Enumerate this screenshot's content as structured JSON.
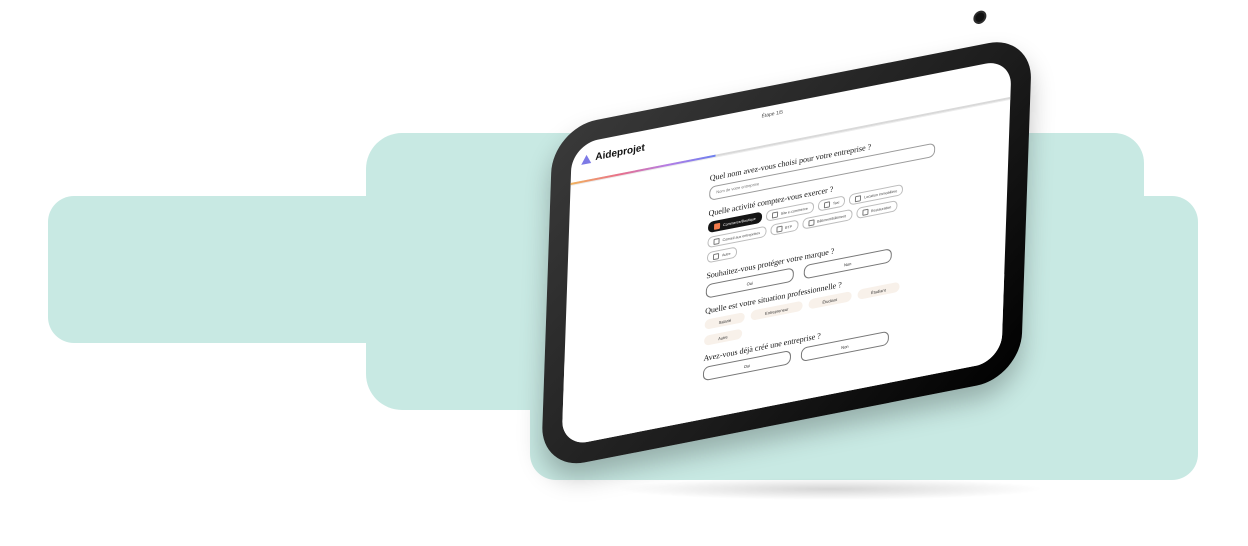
{
  "app": {
    "brand": "Aideprojet",
    "step": "Étape 1/5",
    "progress": 0.33
  },
  "questions": {
    "company_name": {
      "label": "Quel nom avez-vous choisi pour votre entreprise ?",
      "placeholder": "Nom de votre entreprise"
    },
    "activity": {
      "label": "Quelle activité comptez-vous exercer ?",
      "options": [
        {
          "label": "Commerce/Boutique",
          "selected": true
        },
        {
          "label": "Site e-commerce",
          "selected": false
        },
        {
          "label": "Taxi",
          "selected": false
        },
        {
          "label": "Location immobilière",
          "selected": false
        },
        {
          "label": "Conseil aux entreprises",
          "selected": false
        },
        {
          "label": "BTP",
          "selected": false
        },
        {
          "label": "Bâtiment/bâtiment",
          "selected": false
        },
        {
          "label": "Restauration",
          "selected": false
        },
        {
          "label": "Autre",
          "selected": false
        }
      ]
    },
    "brand_protection": {
      "label": "Souhaitez-vous protéger votre marque ?",
      "yes": "Oui",
      "no": "Non"
    },
    "situation": {
      "label": "Quelle est votre situation professionnelle ?",
      "options": [
        "Salarié",
        "Entrepreneur",
        "Étudiant",
        "Étudiant",
        "Autre"
      ]
    },
    "company_created": {
      "label": "Avez-vous déjà créé une entreprise ?",
      "yes": "Oui",
      "no": "Non"
    }
  },
  "colors": {
    "background_shape": "#c8e9e3",
    "selected_chip": "#151515",
    "checkbox_selected": "#f47c4c",
    "pill_bg": "#f8f1ea"
  }
}
